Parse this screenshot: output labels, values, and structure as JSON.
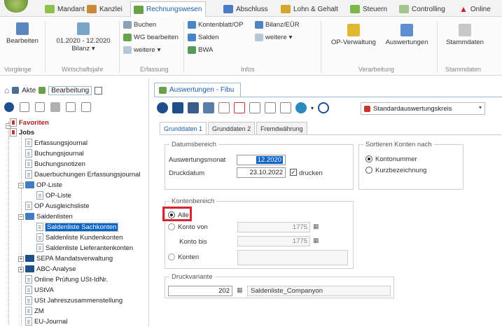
{
  "tabs": [
    "Mandant",
    "Kanzlei",
    "Rechnungswesen",
    "Abschluss",
    "Lohn & Gehalt",
    "Steuern",
    "Controlling",
    "Online"
  ],
  "ribbon": {
    "bearbeiten": "Bearbeiten",
    "vorgaenge": "Vorgänge",
    "wj_value": "01.2020 - 12.2020",
    "wj_sub": "Bilanz",
    "wj_label": "Wirtschaftsjahr",
    "buchen": "Buchen",
    "wg_bearbeiten": "WG bearbeiten",
    "weitere1": "weitere",
    "erfassung": "Erfassung",
    "kontenblatt": "Kontenblatt/OP",
    "salden": "Salden",
    "bwa": "BWA",
    "bilanz_euer": "Bilanz/EÜR",
    "weitere2": "weitere",
    "infos": "Infos",
    "op_verwaltung": "OP-Verwaltung",
    "auswertungen": "Auswertungen",
    "verarbeitung": "Verarbeitung",
    "stammdaten": "Stammdaten",
    "stammdaten_grp": "Stammdaten"
  },
  "left": {
    "akte": "Akte",
    "bearbeitung": "Bearbeitung",
    "tree": [
      "Favoriten",
      "Jobs",
      "Erfassungsjournal",
      "Buchungsjournal",
      "Buchungsnotizen",
      "Dauerbuchungen Erfassungsjournal",
      "OP-Liste",
      "OP-Liste",
      "OP Ausgleichsliste",
      "Saldenlisten",
      "Saldenliste Sachkonten",
      "Saldenliste Kundenkonten",
      "Saldenliste Lieferantenkonten",
      "SEPA Mandatsverwaltung",
      "ABC-Analyse",
      "Online Prüfung USt-IdNr.",
      "UStVA",
      "USt Jahreszusammenstellung",
      "ZM",
      "EU-Journal"
    ]
  },
  "right": {
    "doc_tab": "Auswertungen - Fibu",
    "combo": "Standardauswertungskreis",
    "inner_tabs": [
      "Grunddaten 1",
      "Grunddaten 2",
      "Fremdwährung"
    ],
    "datumsbereich": "Datumsbereich",
    "auswertungsmonat_label": "Auswertungsmonat",
    "auswertungsmonat_value": "12.2020",
    "druckdatum_label": "Druckdatum",
    "druckdatum_value": "23.10.2022",
    "drucken": "drucken",
    "sortieren": "Sortieren Konten nach",
    "kontonummer": "Kontonummer",
    "kurzbezeichnung": "Kurzbezeichnung",
    "kontenbereich": "Kontenbereich",
    "alle": "Alle",
    "konto_von": "Konto von",
    "konto_von_value": "1775",
    "konto_bis": "Konto bis",
    "konto_bis_value": "1775",
    "konten": "Konten",
    "druckvariante": "Druckvariante",
    "druckvariante_nr": "202",
    "druckvariante_name": "Saldenliste_Companyon"
  }
}
